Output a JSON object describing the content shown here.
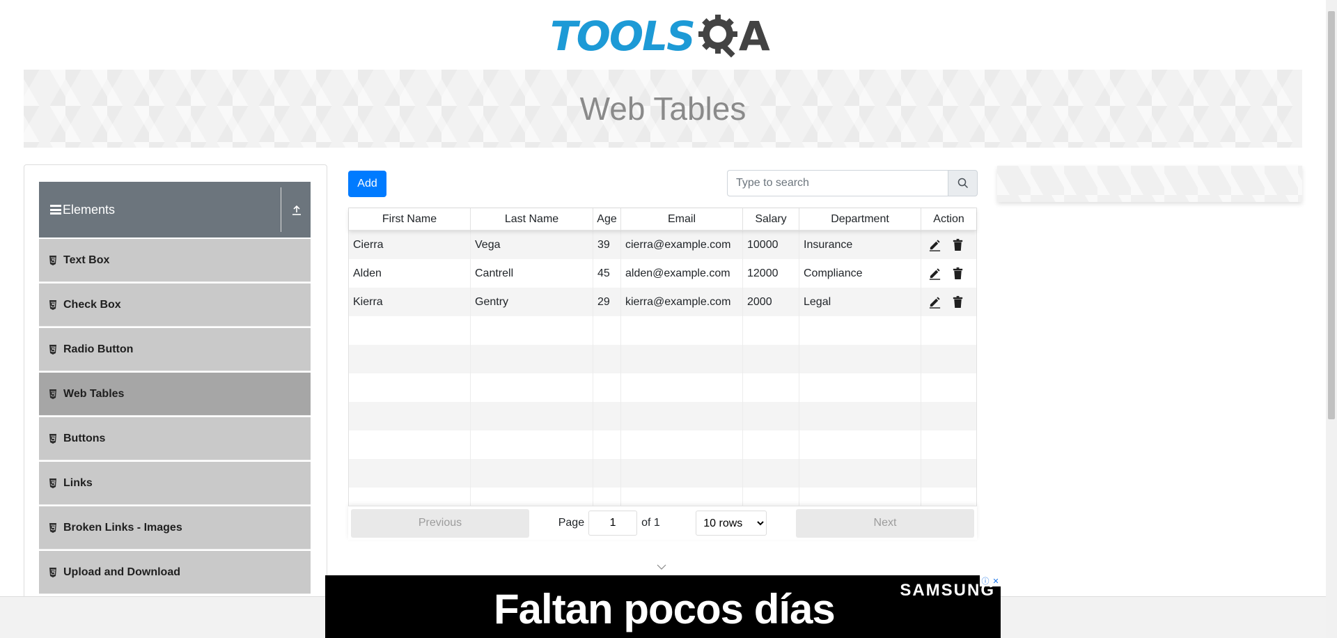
{
  "logo": {
    "text_main": "TOOLS",
    "text_end": "A",
    "icon": "gear-q-icon"
  },
  "page_title": "Web Tables",
  "sidebar": {
    "group_title": "Elements",
    "items": [
      {
        "label": "Text Box",
        "active": false
      },
      {
        "label": "Check Box",
        "active": false
      },
      {
        "label": "Radio Button",
        "active": false
      },
      {
        "label": "Web Tables",
        "active": true
      },
      {
        "label": "Buttons",
        "active": false
      },
      {
        "label": "Links",
        "active": false
      },
      {
        "label": "Broken Links - Images",
        "active": false
      },
      {
        "label": "Upload and Download",
        "active": false
      }
    ]
  },
  "toolbar": {
    "add_label": "Add"
  },
  "search": {
    "placeholder": "Type to search",
    "value": ""
  },
  "table": {
    "columns": [
      "First Name",
      "Last Name",
      "Age",
      "Email",
      "Salary",
      "Department",
      "Action"
    ],
    "rows": [
      {
        "first": "Cierra",
        "last": "Vega",
        "age": "39",
        "email": "cierra@example.com",
        "salary": "10000",
        "department": "Insurance"
      },
      {
        "first": "Alden",
        "last": "Cantrell",
        "age": "45",
        "email": "alden@example.com",
        "salary": "12000",
        "department": "Compliance"
      },
      {
        "first": "Kierra",
        "last": "Gentry",
        "age": "29",
        "email": "kierra@example.com",
        "salary": "2000",
        "department": "Legal"
      }
    ]
  },
  "pagination": {
    "previous_label": "Previous",
    "next_label": "Next",
    "page_label": "Page",
    "page_value": "1",
    "of_label": "of 1",
    "rows_selected": "10 rows"
  },
  "ad": {
    "headline": "Faltan pocos días",
    "brand": "SAMSUNG"
  },
  "colors": {
    "brand_blue": "#1d9ad6",
    "primary_button": "#007bff",
    "sidebar_header": "#6c757d",
    "menu_item": "#c9c9c9",
    "menu_item_active": "#a6a6a6"
  }
}
